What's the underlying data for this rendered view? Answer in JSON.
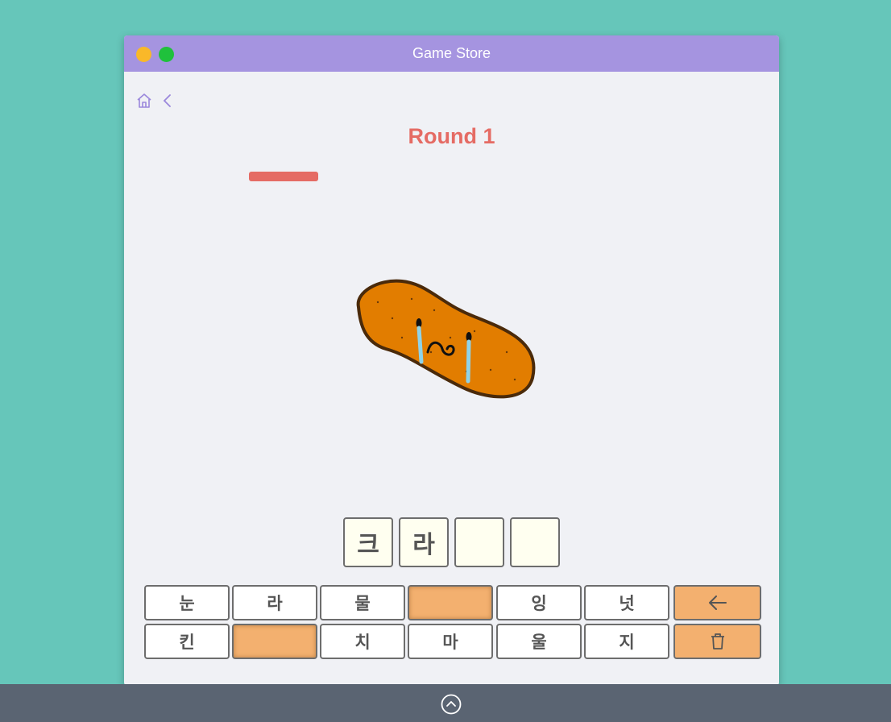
{
  "window": {
    "title": "Game Store"
  },
  "nav": {
    "home_icon": "home-icon",
    "back_icon": "chevron-left-icon"
  },
  "game": {
    "round_label": "Round 1",
    "timer_fraction": 0.17,
    "answer_slots": [
      "크",
      "라",
      "",
      ""
    ],
    "keyboard": {
      "row1": [
        "눈",
        "라",
        "물",
        "",
        "잉",
        "넛"
      ],
      "row2": [
        "킨",
        "",
        "치",
        "마",
        "울",
        "지"
      ],
      "backspace_icon": "arrow-left-icon",
      "clear_icon": "trash-icon"
    }
  },
  "colors": {
    "background": "#66c6ba",
    "titlebar": "#a594e0",
    "accent": "#e56b64",
    "key_used": "#f3b06f"
  },
  "taskbar": {
    "icon": "chevron-up-circle-icon"
  }
}
